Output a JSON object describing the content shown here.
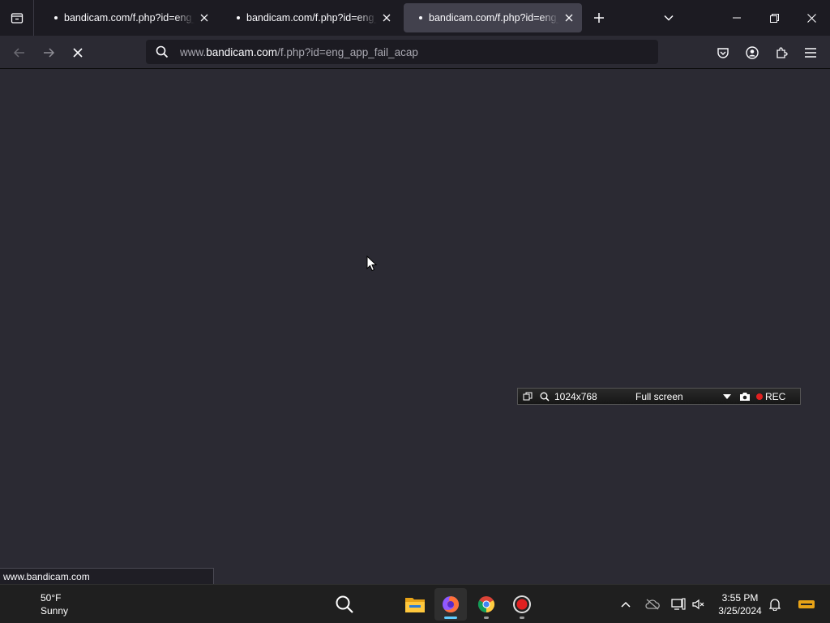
{
  "browser": {
    "tabs": [
      {
        "title": "bandicam.com/f.php?id=eng_app_fail_acap",
        "active": false
      },
      {
        "title": "bandicam.com/f.php?id=eng_app_fail_acap",
        "active": false
      },
      {
        "title": "bandicam.com/f.php?id=eng_app_fail_acap",
        "active": true
      }
    ],
    "url": {
      "prefix": "www.",
      "domain": "bandicam.com",
      "path": "/f.php?id=eng_app_fail_acap"
    },
    "status_text": "www.bandicam.com"
  },
  "bandicam": {
    "size": "1024x768",
    "mode": "Full screen",
    "rec_label": "REC"
  },
  "taskbar": {
    "weather": {
      "temp": "50°F",
      "condition": "Sunny"
    },
    "clock": {
      "time": "3:55 PM",
      "date": "3/25/2024"
    }
  },
  "colors": {
    "accent": "#60cdff",
    "rec": "#e02020",
    "chrome_bg": "#1c1b22",
    "content_bg": "#2b2a33"
  }
}
